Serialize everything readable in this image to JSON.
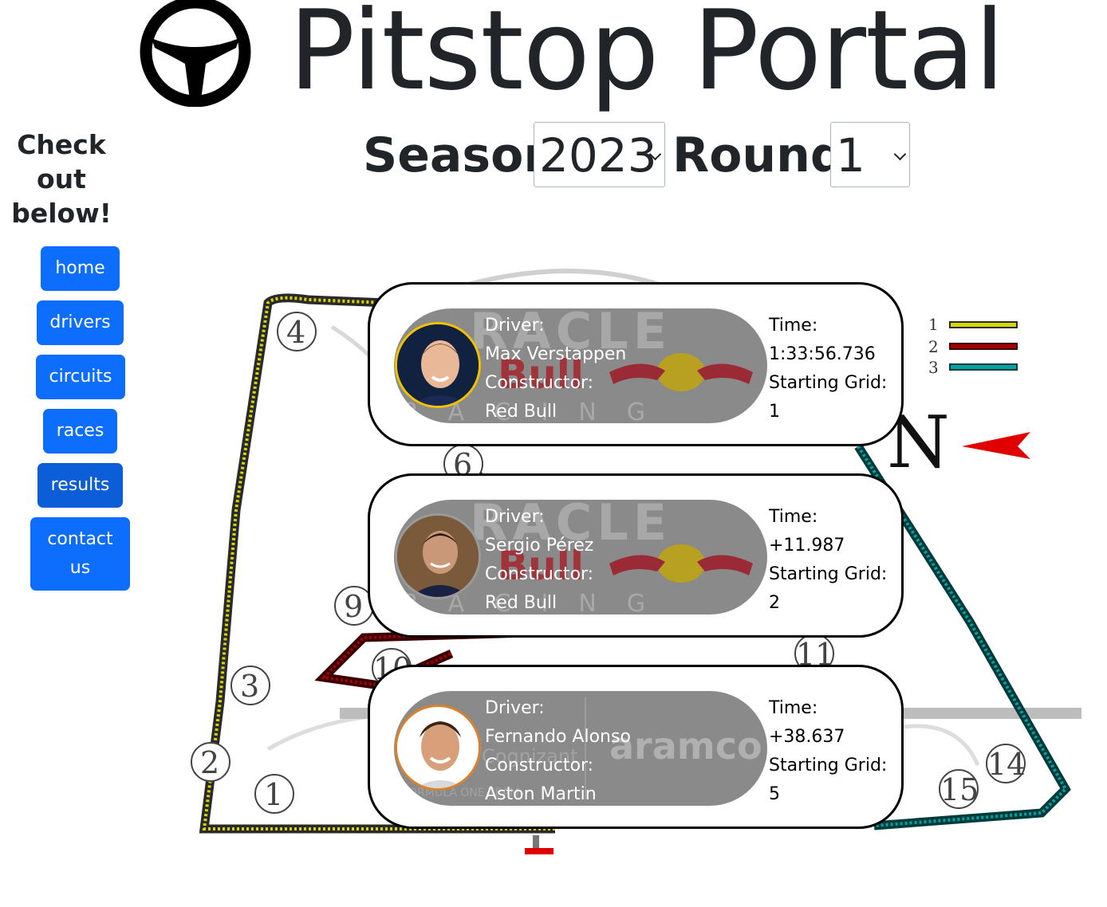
{
  "header": {
    "title": "Pitstop Portal",
    "logo_icon": "steering-wheel-icon"
  },
  "selectors": {
    "season_label": "Season:",
    "season_value": "2023",
    "round_label": "Round:",
    "round_value": "1"
  },
  "sidebar": {
    "heading": "Check out below!",
    "heading_lines": [
      "Check",
      "out",
      "below!"
    ],
    "items": [
      {
        "label": "home"
      },
      {
        "label": "drivers"
      },
      {
        "label": "circuits"
      },
      {
        "label": "races"
      },
      {
        "label": "results",
        "active": true
      },
      {
        "label": "contact us",
        "lines": [
          "contact",
          "us"
        ]
      }
    ]
  },
  "track_map": {
    "turn_labels": [
      "1",
      "2",
      "3",
      "4",
      "6",
      "9",
      "10",
      "11",
      "14",
      "15"
    ],
    "legend": [
      "1",
      "2",
      "3"
    ],
    "north": "N",
    "colors": {
      "sector1": "#d6d600",
      "sector2": "#a30000",
      "sector3": "#00a3a3"
    }
  },
  "results": [
    {
      "driver_label": "Driver:",
      "driver": "Max Verstappen",
      "constructor_label": "Constructor:",
      "constructor": "Red Bull",
      "time_label": "Time:",
      "time": "1:33:56.736",
      "grid_label": "Starting Grid:",
      "grid": "1",
      "avatar_border": "#f2c200"
    },
    {
      "driver_label": "Driver:",
      "driver": "Sergio Pérez",
      "constructor_label": "Constructor:",
      "constructor": "Red Bull",
      "time_label": "Time:",
      "time": "+11.987",
      "grid_label": "Starting Grid:",
      "grid": "2",
      "avatar_border": "#9a9a9a"
    },
    {
      "driver_label": "Driver:",
      "driver": "Fernando Alonso",
      "constructor_label": "Constructor:",
      "constructor": "Aston Martin",
      "time_label": "Time:",
      "time": "+38.637",
      "grid_label": "Starting Grid:",
      "grid": "5",
      "avatar_border": "#d9822b"
    }
  ],
  "colors": {
    "primary": "#0d6efd",
    "active": "#0b5ed7",
    "text": "#212529",
    "pill": "#8a8a8a"
  }
}
